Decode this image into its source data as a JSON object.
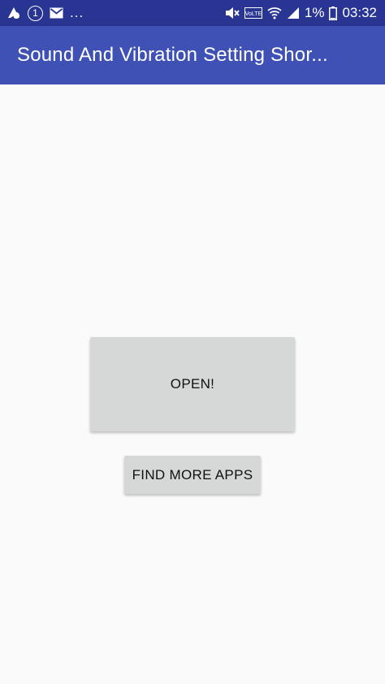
{
  "status_bar": {
    "time": "03:32",
    "battery_percent": "1%",
    "notification_count": "1",
    "more_indicator": "...",
    "volte_label": "VoLTE",
    "icons": [
      "app-notification-icon",
      "badge-one-icon",
      "mail-icon",
      "mute-icon",
      "volte-icon",
      "wifi-icon",
      "signal-icon",
      "battery-icon"
    ]
  },
  "app_bar": {
    "title": "Sound And Vibration Setting Shor..."
  },
  "main": {
    "open_button_label": "OPEN!",
    "find_more_button_label": "FIND MORE APPS"
  },
  "colors": {
    "status_bar": "#283593",
    "app_bar": "#3f51b5",
    "background": "#fafafa",
    "button": "#d6d7d7"
  }
}
